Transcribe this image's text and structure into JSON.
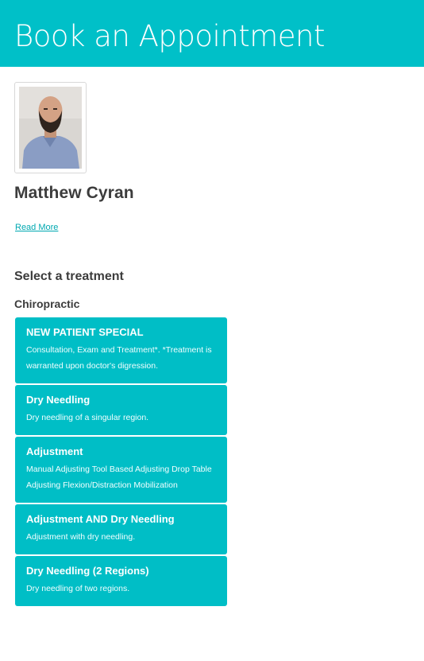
{
  "header": {
    "title": "Book an Appointment"
  },
  "provider": {
    "name": "Matthew Cyran",
    "read_more": "Read More",
    "photo_icon": "provider-photo"
  },
  "section_title": "Select a treatment",
  "category": "Chiropractic",
  "treatments": [
    {
      "title": "NEW PATIENT SPECIAL",
      "description": "Consultation, Exam and Treatment*. *Treatment is warranted upon doctor's digression."
    },
    {
      "title": "Dry Needling",
      "description": "Dry needling of a singular region."
    },
    {
      "title": "Adjustment",
      "description": "Manual Adjusting Tool Based Adjusting Drop Table Adjusting Flexion/Distraction Mobilization"
    },
    {
      "title": "Adjustment AND Dry Needling",
      "description": "Adjustment with dry needling."
    },
    {
      "title": "Dry Needling (2 Regions)",
      "description": "Dry needling of two regions."
    }
  ],
  "colors": {
    "accent": "#00c0c8",
    "link": "#00a9b1",
    "text": "#3c3c3c"
  }
}
